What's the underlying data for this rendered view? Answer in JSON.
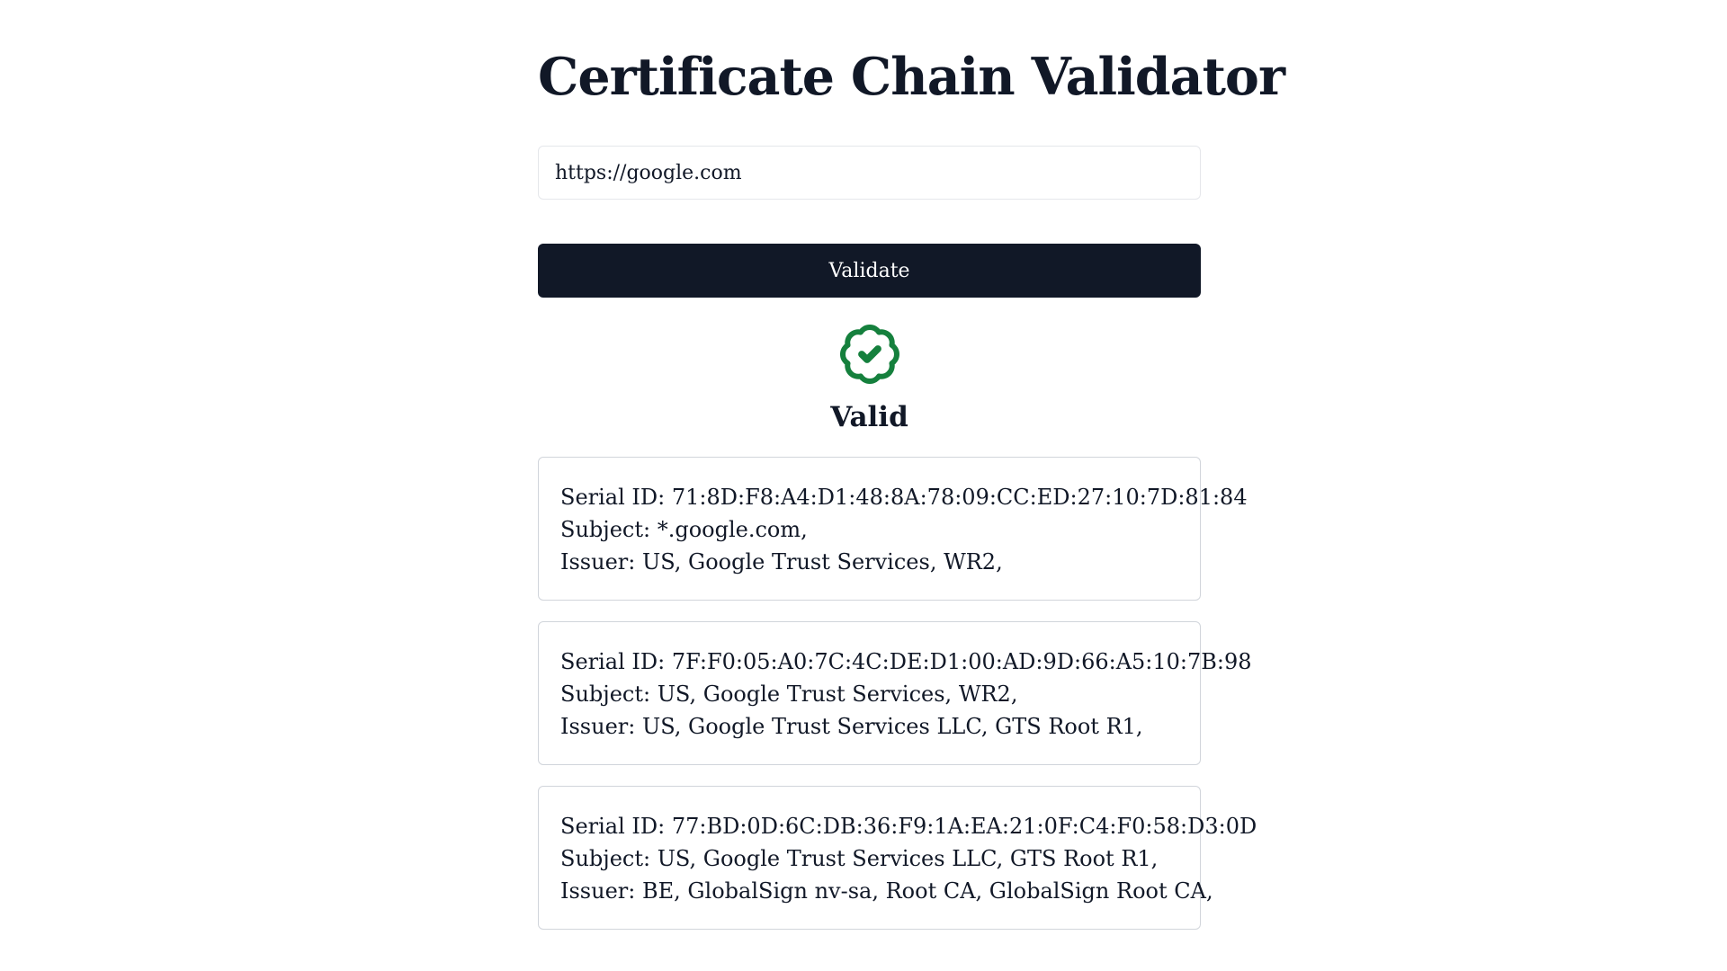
{
  "page": {
    "title": "Certificate Chain Validator"
  },
  "form": {
    "url_value": "https://google.com",
    "validate_label": "Validate"
  },
  "result": {
    "status_icon": "badge-check-icon",
    "status_color": "#15803d",
    "status_label": "Valid"
  },
  "certificates": [
    {
      "serial": "Serial ID: 71:8D:F8:A4:D1:48:8A:78:09:CC:ED:27:10:7D:81:84",
      "subject": "Subject: *.google.com,",
      "issuer": "Issuer: US, Google Trust Services, WR2,"
    },
    {
      "serial": "Serial ID: 7F:F0:05:A0:7C:4C:DE:D1:00:AD:9D:66:A5:10:7B:98",
      "subject": "Subject: US, Google Trust Services, WR2,",
      "issuer": "Issuer: US, Google Trust Services LLC, GTS Root R1,"
    },
    {
      "serial": "Serial ID: 77:BD:0D:6C:DB:36:F9:1A:EA:21:0F:C4:F0:58:D3:0D",
      "subject": "Subject: US, Google Trust Services LLC, GTS Root R1,",
      "issuer": "Issuer: BE, GlobalSign nv-sa, Root CA, GlobalSign Root CA,"
    }
  ],
  "colors": {
    "primary": "#111827",
    "border": "#d1d5db",
    "success": "#15803d"
  }
}
